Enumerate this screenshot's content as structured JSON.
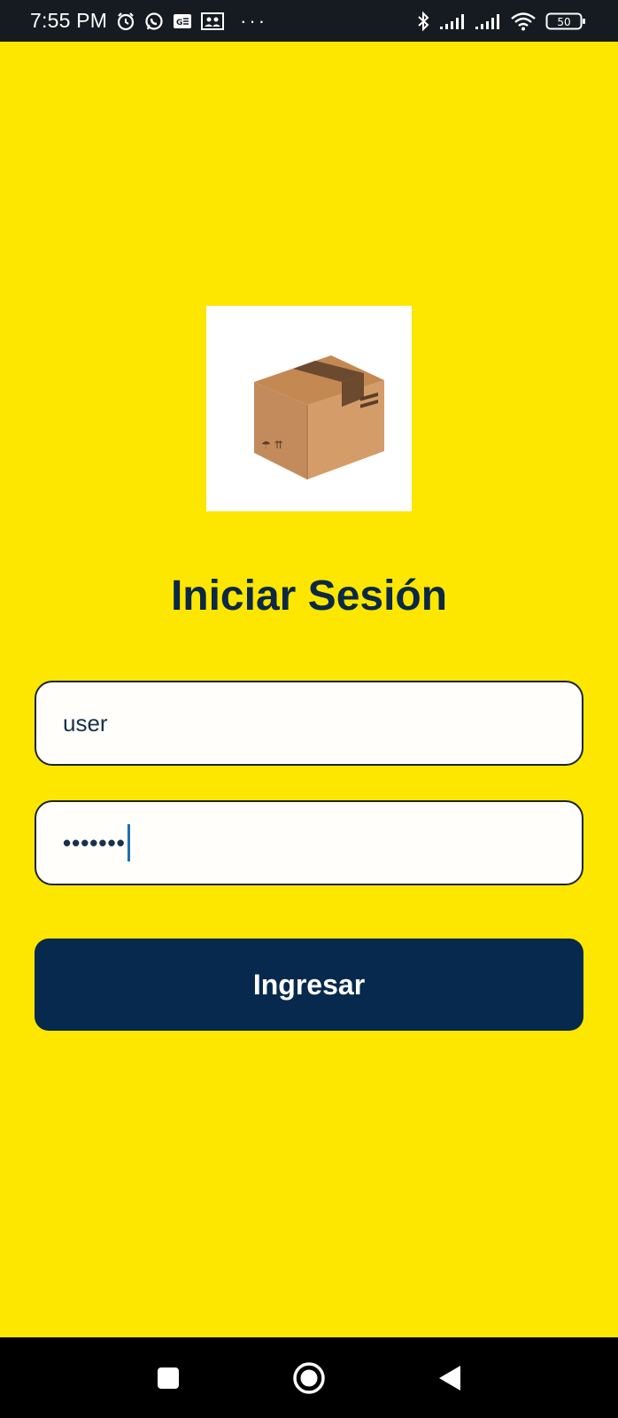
{
  "status_bar": {
    "time": "7:55 PM",
    "icons": [
      "alarm-icon",
      "whatsapp-icon",
      "sim-card-icon",
      "people-icon",
      "more-dots-icon",
      "bluetooth-icon",
      "signal-icon",
      "signal-icon",
      "wifi-icon",
      "battery-icon"
    ],
    "battery": "50",
    "more": "···"
  },
  "login": {
    "logo": "package-box-icon",
    "title": "Iniciar Sesión",
    "username_value": "user",
    "password_masked": "•••••••",
    "submit_label": "Ingresar"
  },
  "nav": {
    "icons": [
      "recents-square-icon",
      "home-circle-icon",
      "back-triangle-icon"
    ]
  },
  "colors": {
    "background": "#fde600",
    "primary": "#07294d",
    "title": "#0b2844",
    "caret": "#1f6fb0"
  }
}
